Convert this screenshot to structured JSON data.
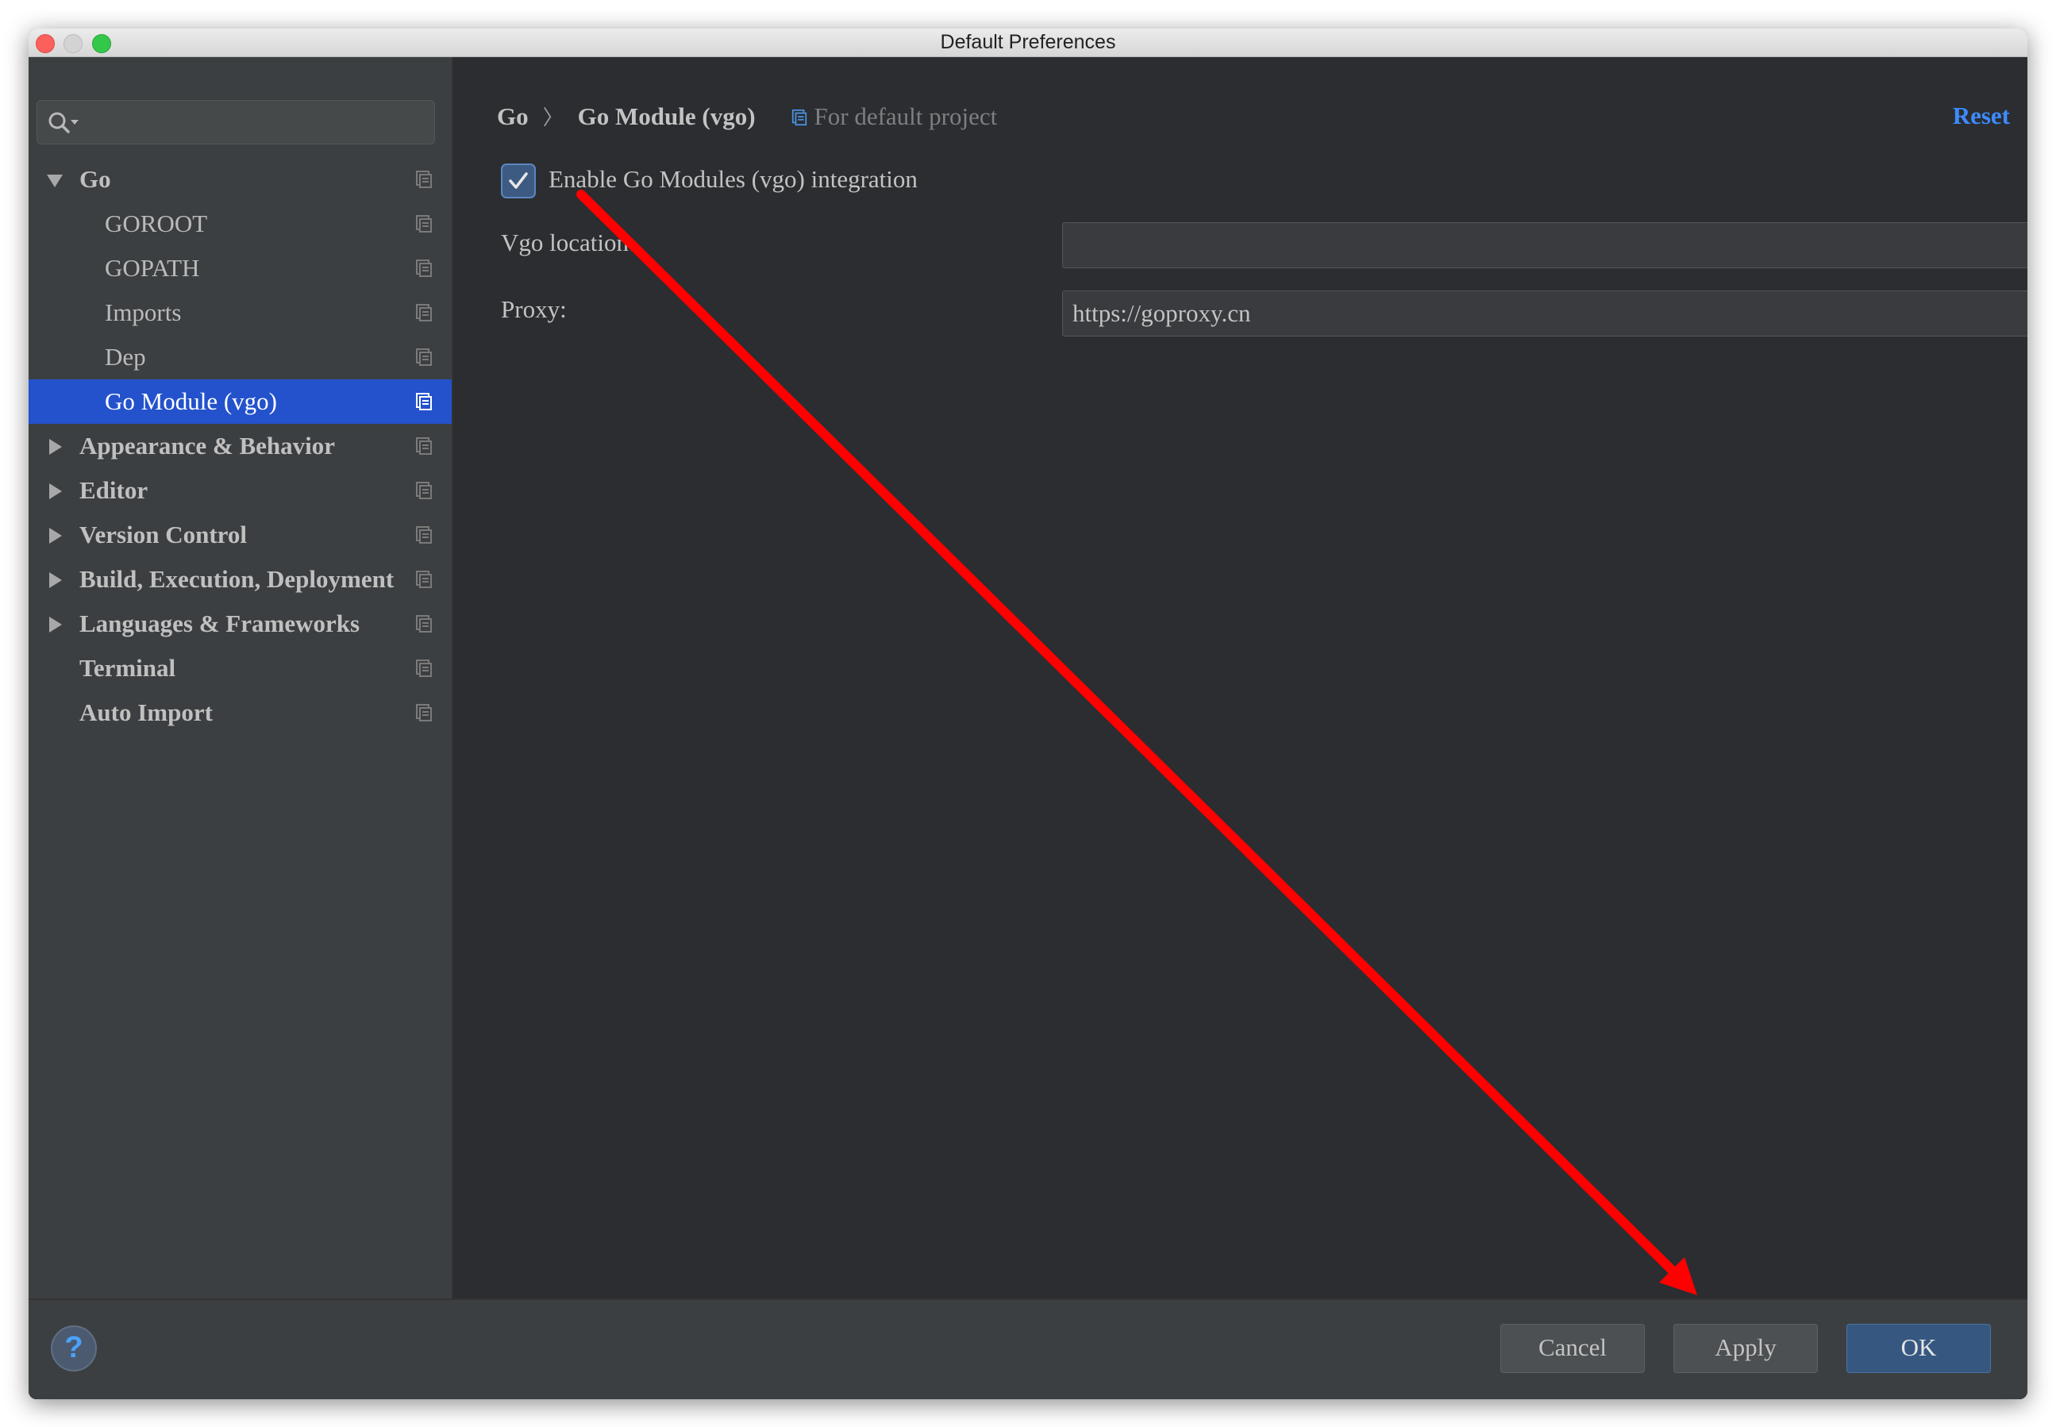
{
  "window": {
    "title": "Default Preferences"
  },
  "search": {
    "placeholder": ""
  },
  "sidebar": {
    "items": [
      {
        "label": "Go",
        "expanded": true
      },
      {
        "label": "GOROOT"
      },
      {
        "label": "GOPATH"
      },
      {
        "label": "Imports"
      },
      {
        "label": "Dep"
      },
      {
        "label": "Go Module (vgo)",
        "selected": true
      },
      {
        "label": "Appearance & Behavior",
        "expanded": false
      },
      {
        "label": "Editor",
        "expanded": false
      },
      {
        "label": "Version Control",
        "expanded": false
      },
      {
        "label": "Build, Execution, Deployment",
        "expanded": false
      },
      {
        "label": "Languages & Frameworks",
        "expanded": false
      },
      {
        "label": "Terminal"
      },
      {
        "label": "Auto Import"
      }
    ]
  },
  "breadcrumb": {
    "root": "Go",
    "current": "Go Module (vgo)",
    "scope": "For default project"
  },
  "header": {
    "reset_label": "Reset"
  },
  "settings": {
    "enable_label": "Enable Go Modules (vgo) integration",
    "enable_checked": true,
    "vgo_location_label": "Vgo location:",
    "vgo_location_value": "",
    "browse_label": "...",
    "proxy_label": "Proxy:",
    "proxy_value": "https://goproxy.cn",
    "help_mark": "?"
  },
  "footer": {
    "help_label": "?",
    "cancel_label": "Cancel",
    "apply_label": "Apply",
    "ok_label": "OK"
  },
  "colors": {
    "selection": "#2352cc",
    "reset_link": "#3d8bff",
    "annotation_arrow": "#ff0000"
  }
}
